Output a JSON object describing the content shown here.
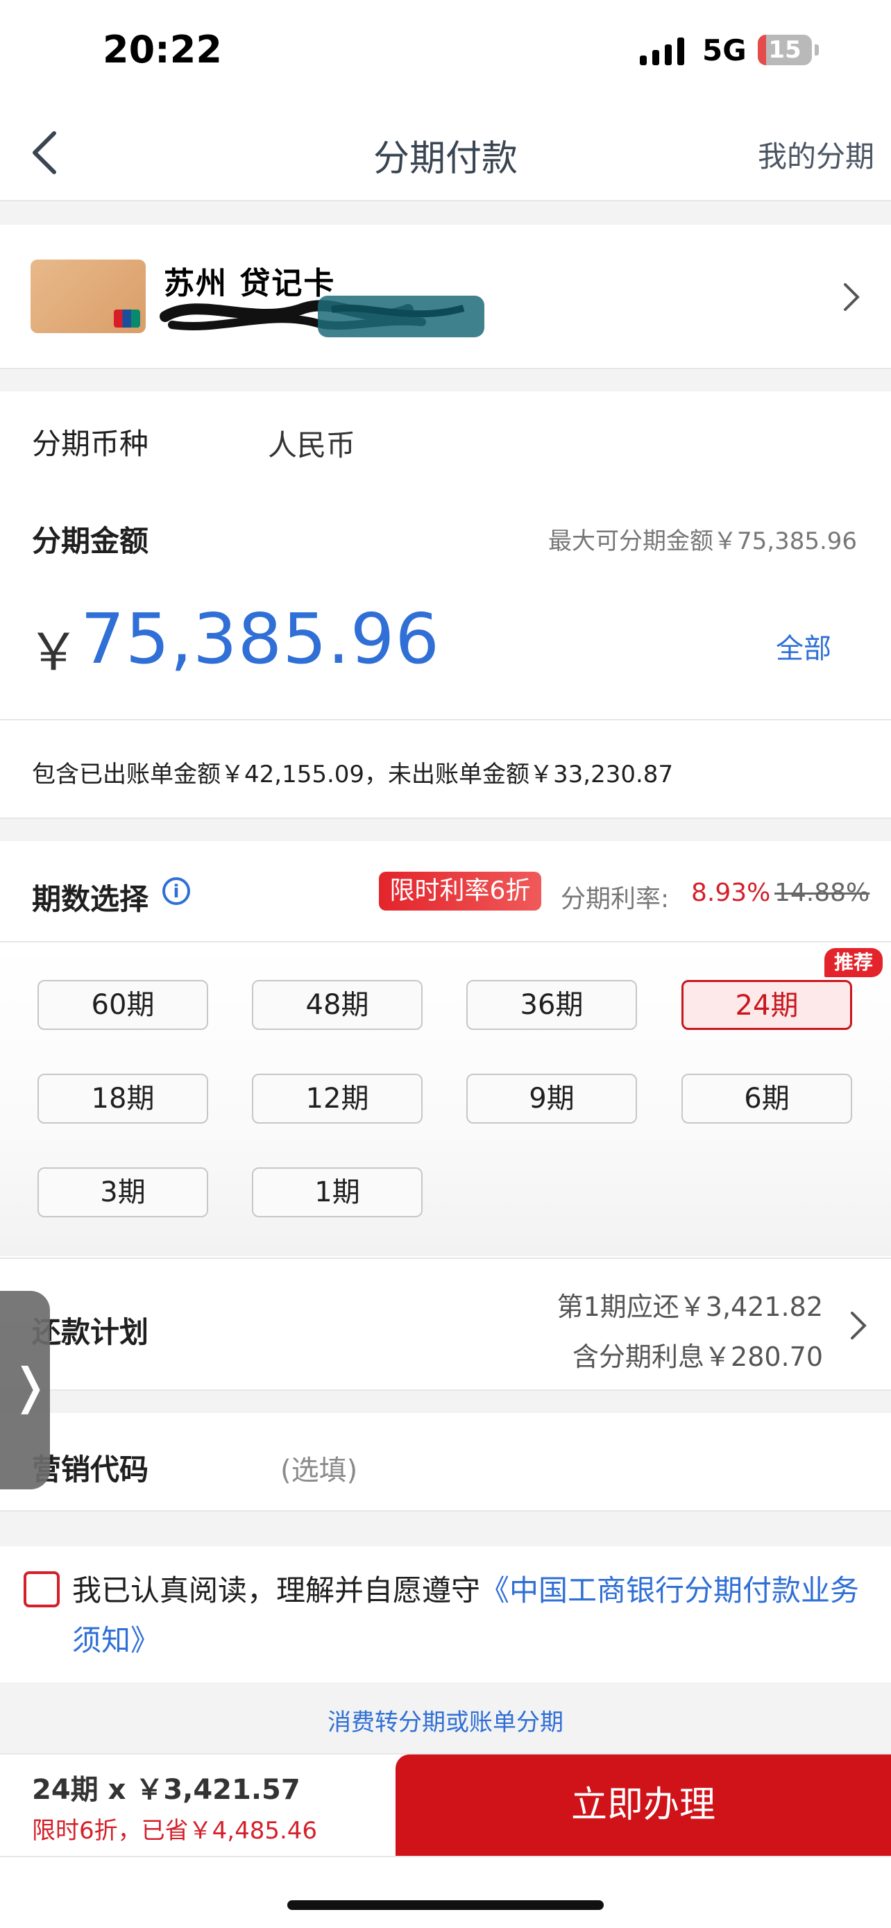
{
  "status_bar": {
    "time": "20:22",
    "network": "5G",
    "battery": "15",
    "battery_level": 0.15
  },
  "nav": {
    "title": "分期付款",
    "my_installments": "我的分期"
  },
  "card": {
    "name": "苏州 贷记卡"
  },
  "currency": {
    "label": "分期币种",
    "value": "人民币"
  },
  "amount": {
    "label": "分期金额",
    "max_label": "最大可分期金额￥75,385.96",
    "symbol": "￥",
    "value": "75,385.96",
    "all_button": "全部",
    "breakdown": "包含已出账单金额￥42,155.09，未出账单金额￥33,230.87"
  },
  "period": {
    "label": "期数选择",
    "promo_badge": "限时利率6折",
    "rate_label": "分期利率:",
    "rate": "8.93%",
    "original_rate": "14.88%",
    "recommend_tag": "推荐",
    "options": [
      "60期",
      "48期",
      "36期",
      "24期",
      "18期",
      "12期",
      "9期",
      "6期",
      "3期",
      "1期"
    ],
    "selected": "24期"
  },
  "repayment": {
    "label": "还款计划",
    "first_payment": "第1期应还￥3,421.82",
    "interest": "含分期利息￥280.70"
  },
  "promo_code": {
    "label": "营销代码",
    "placeholder": "(选填)"
  },
  "agreement": {
    "text": "我已认真阅读，理解并自愿遵守",
    "link": "《中国工商银行分期付款业务须知》"
  },
  "switch_link": "消费转分期或账单分期",
  "summary": {
    "total": "24期 x ￥3,421.57",
    "saving": "限时6折，已省￥4,485.46"
  },
  "submit": "立即办理",
  "colors": {
    "accent_blue": "#2f6fd6",
    "accent_red": "#d01219"
  }
}
